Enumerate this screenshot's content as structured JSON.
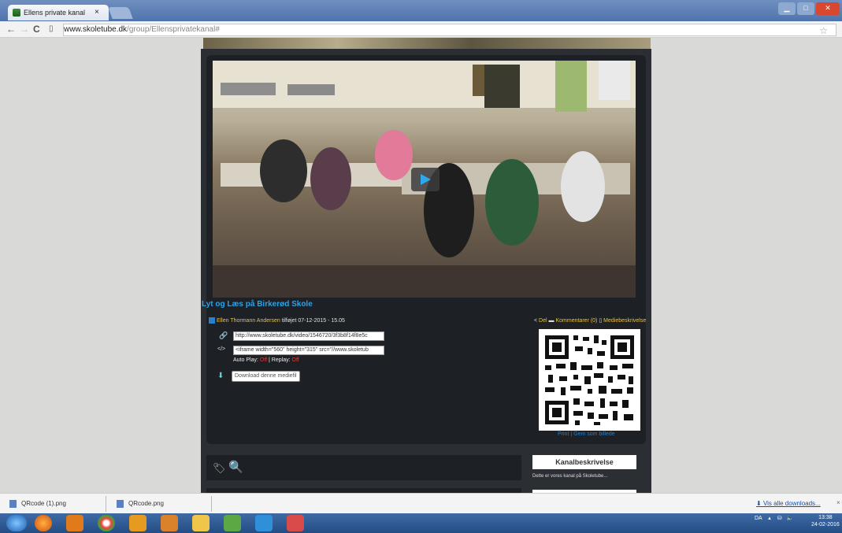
{
  "browser": {
    "tab_title": "Ellens private kanal",
    "tab_close": "×",
    "url_domain": "www.skoletube.dk",
    "url_path": "/group/Ellensprivatekanal#"
  },
  "video": {
    "title": "Lyt og Læs på Birkerød Skole",
    "author": "Ellen Thormann Andersen",
    "added": "tilføjet 07-12-2015 - 15.05",
    "share": "Del",
    "comments": "Kommentarer (0)",
    "description": "Mediebeskrivelse",
    "link_value": "http://www.skoletube.dk/video/1546720/3f3b8f14f8e5c",
    "embed_value": "<iframe width=\"560\" height=\"315\" src=\"//www.skoletub",
    "autoplay_label": "Auto Play:",
    "autoplay_value": "Off",
    "replay_label": "| Replay:",
    "replay_value": "Off",
    "download_label": "Download denne mediefil",
    "qr_print": "Print",
    "qr_save": "| Gem som billede"
  },
  "channel": {
    "heading": "Kanalbeskrivelse",
    "text": "Dette er vores kanal på Skoletube..."
  },
  "downloads": {
    "items": [
      "QRcode (1).png",
      "QRcode.png"
    ],
    "show_all": "Vis alle downloads...",
    "close": "×"
  },
  "taskbar": {
    "lang": "DA",
    "time": "13:38",
    "date": "24-02-2016"
  },
  "colors": {
    "accent": "#2ba3e6",
    "author": "#e6c24a",
    "off": "#e23d3d"
  }
}
